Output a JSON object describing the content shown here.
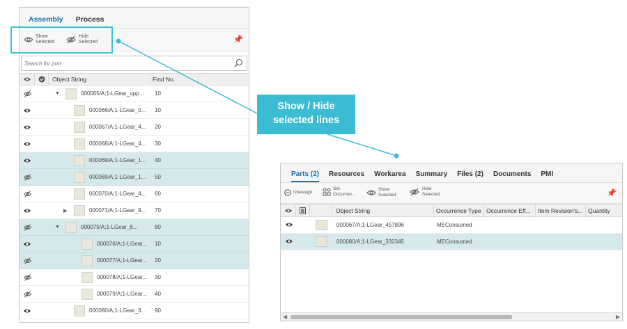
{
  "left_panel": {
    "tabs": [
      "Assembly",
      "Process"
    ],
    "toolbar": {
      "show_selected": [
        "Show",
        "Selected"
      ],
      "hide_selected": [
        "Hide",
        "Selected"
      ]
    },
    "search": {
      "placeholder": "Search for port"
    },
    "columns": {
      "object_string": "Object String",
      "find_no": "Find No."
    },
    "rows": [
      {
        "eye": "hidden",
        "indent": 0,
        "chevron": "down",
        "object": "000065/A;1-LGear_upp...",
        "find_no": "10",
        "selected": false
      },
      {
        "eye": "visible",
        "indent": 1,
        "chevron": "",
        "object": "000066/A;1-LGear_0...",
        "find_no": "10",
        "selected": false
      },
      {
        "eye": "visible",
        "indent": 1,
        "chevron": "",
        "object": "000067/A;1-LGear_4...",
        "find_no": "20",
        "selected": false
      },
      {
        "eye": "visible",
        "indent": 1,
        "chevron": "",
        "object": "000068/A;1-LGear_4...",
        "find_no": "30",
        "selected": false
      },
      {
        "eye": "visible",
        "indent": 1,
        "chevron": "",
        "object": "000069/A;1-LGear_1...",
        "find_no": "40",
        "selected": true
      },
      {
        "eye": "hidden",
        "indent": 1,
        "chevron": "",
        "object": "000069/A;1-LGear_1...",
        "find_no": "50",
        "selected": true
      },
      {
        "eye": "hidden",
        "indent": 1,
        "chevron": "",
        "object": "000070/A;1-LGear_4...",
        "find_no": "60",
        "selected": false
      },
      {
        "eye": "visible",
        "indent": 1,
        "chevron": "right",
        "object": "000071/A;1-LGear_9...",
        "find_no": "70",
        "selected": false
      },
      {
        "eye": "hidden",
        "indent": 0,
        "chevron": "down",
        "object": "000075/A;1-LGear_6...",
        "find_no": "80",
        "selected": true
      },
      {
        "eye": "visible",
        "indent": 2,
        "chevron": "",
        "object": "000076/A;1-LGear...",
        "find_no": "10",
        "selected": true
      },
      {
        "eye": "hidden",
        "indent": 2,
        "chevron": "",
        "object": "000077/A;1-LGear...",
        "find_no": "20",
        "selected": true
      },
      {
        "eye": "hidden",
        "indent": 2,
        "chevron": "",
        "object": "000078/A;1-LGear...",
        "find_no": "30",
        "selected": false
      },
      {
        "eye": "hidden",
        "indent": 2,
        "chevron": "",
        "object": "000079/A;1-LGear...",
        "find_no": "40",
        "selected": false
      },
      {
        "eye": "visible",
        "indent": 1,
        "chevron": "",
        "object": "000080/A;1-LGear_3...",
        "find_no": "90",
        "selected": false
      }
    ]
  },
  "callout": {
    "line1": "Show / Hide",
    "line2": "selected lines"
  },
  "right_panel": {
    "tabs": [
      "Parts (2)",
      "Resources",
      "Workarea",
      "Summary",
      "Files (2)",
      "Documents",
      "PMI"
    ],
    "toolbar": {
      "unassign": "Unassign",
      "set_occurrence": [
        "Set",
        "Occurren..."
      ],
      "show_selected": [
        "Show",
        "Selected"
      ],
      "hide_selected": [
        "Hide",
        "Selected"
      ]
    },
    "columns": [
      "Object String",
      "Occurrence Type",
      "Occurrence Eff...",
      "Item Revision's...",
      "Quantity"
    ],
    "rows": [
      {
        "object": "000067/A;1-LGear_457896",
        "occurrence_type": "MEConsumed",
        "selected": false
      },
      {
        "object": "000080/A;1-LGear_332345",
        "occurrence_type": "MEConsumed",
        "selected": true
      }
    ]
  },
  "colors": {
    "accent": "#3bbcd2",
    "selection": "#d5e8ec",
    "tab_active": "#1c6fa8"
  }
}
